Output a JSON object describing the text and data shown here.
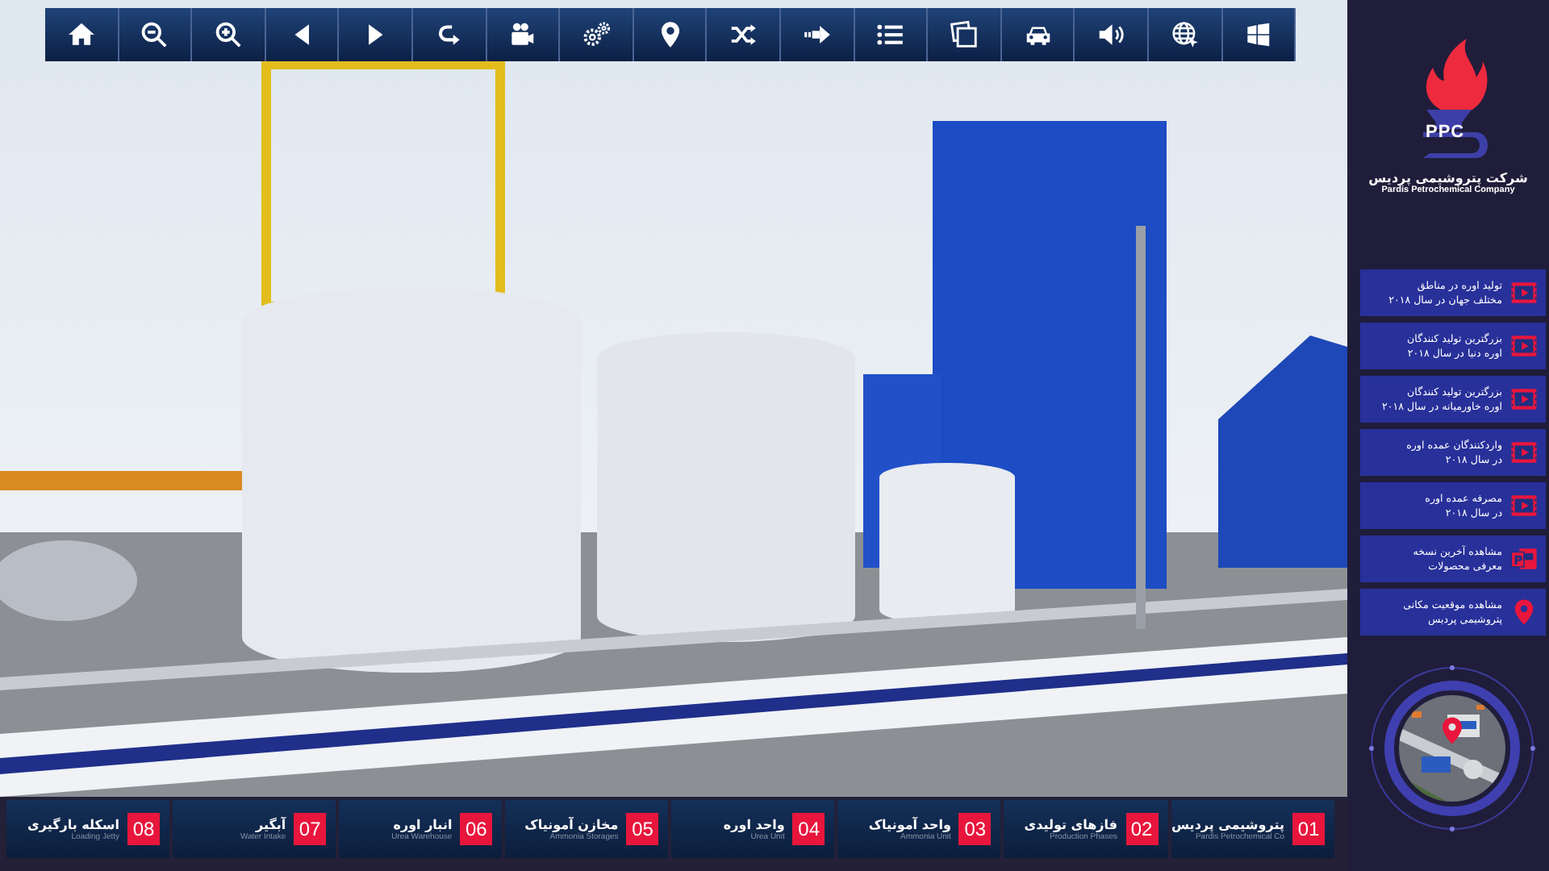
{
  "toolbar": [
    {
      "kind": "home"
    },
    {
      "kind": "zoom-out"
    },
    {
      "kind": "zoom-in"
    },
    {
      "kind": "prev"
    },
    {
      "kind": "next"
    },
    {
      "kind": "rotate"
    },
    {
      "kind": "camera"
    },
    {
      "kind": "gears"
    },
    {
      "kind": "pin"
    },
    {
      "kind": "shuffle"
    },
    {
      "kind": "forward"
    },
    {
      "kind": "list"
    },
    {
      "kind": "photos"
    },
    {
      "kind": "car"
    },
    {
      "kind": "volume"
    },
    {
      "kind": "globe"
    },
    {
      "kind": "panes"
    }
  ],
  "logo": {
    "mark": "PPC",
    "name": "شرکت پتروشیمی پردیس",
    "subtitle": "Pardis Petrochemical Company"
  },
  "menu": [
    {
      "text": "تولید اوره در مناطق\nمختلف جهان در سال ۲۰۱۸",
      "kind": "video"
    },
    {
      "text": "بزرگترین تولید کنندگان\nاوره دنیا در سال ۲۰۱۸",
      "kind": "video"
    },
    {
      "text": "بزرگترین تولید کنندگان\nاوره خاورمیانه در سال ۲۰۱۸",
      "kind": "video"
    },
    {
      "text": "واردکنندگان عمده اوره\nدر سال ۲۰۱۸",
      "kind": "video"
    },
    {
      "text": "مصرفه عمده اوره\nدر سال ۲۰۱۸",
      "kind": "video"
    },
    {
      "text": "مشاهده آخرین نسخه\nمعرفی محصولات",
      "kind": "slides"
    },
    {
      "text": "مشاهده موقعیت مکانی\nپتروشیمی پردیس",
      "kind": "pin"
    }
  ],
  "sections": [
    {
      "number": "01",
      "title": "پتروشیمی پردیس",
      "subtitle": "Pardis Petrochemical Co"
    },
    {
      "number": "02",
      "title": "فازهای تولیدی",
      "subtitle": "Production Phases"
    },
    {
      "number": "03",
      "title": "واحد آمونیاک",
      "subtitle": "Ammonia Unit"
    },
    {
      "number": "04",
      "title": "واحد اوره",
      "subtitle": "Urea Unit"
    },
    {
      "number": "05",
      "title": "مخازن آمونیاک",
      "subtitle": "Ammonia Storages"
    },
    {
      "number": "06",
      "title": "انبار اوره",
      "subtitle": "Urea Warehouse"
    },
    {
      "number": "07",
      "title": "آبگیر",
      "subtitle": "Water Intake"
    },
    {
      "number": "08",
      "title": "اسکله بارگیری",
      "subtitle": "Loading Jetty"
    }
  ]
}
